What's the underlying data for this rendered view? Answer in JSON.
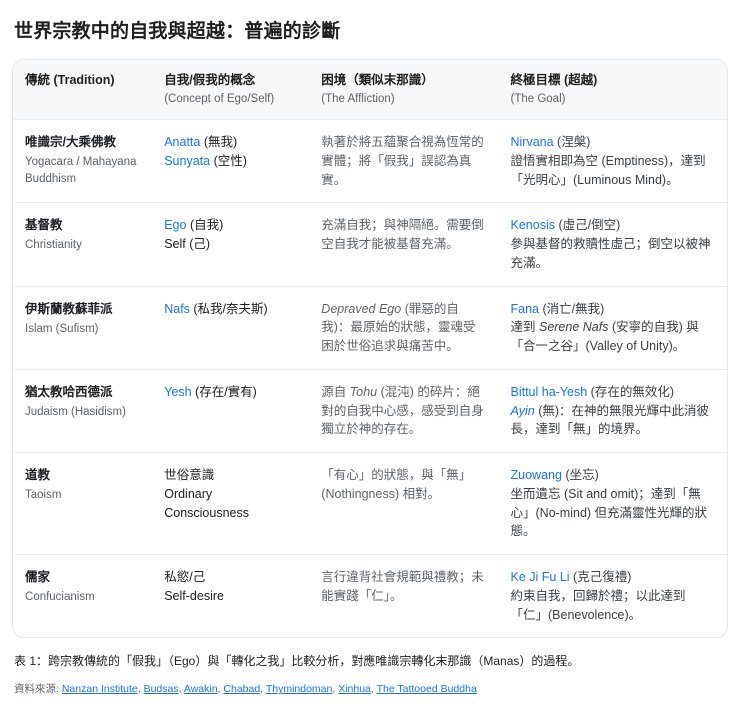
{
  "title": "世界宗教中的自我與超越：普遍的診斷",
  "table": {
    "headers": [
      {
        "main": "傳統 (Tradition)",
        "sub": ""
      },
      {
        "main": "自我/假我的概念",
        "sub": "(Concept of Ego/Self)"
      },
      {
        "main": "困境（類似末那識）",
        "sub": "(The Affliction)"
      },
      {
        "main": "終極目標 (超越)",
        "sub": "(The Goal)"
      }
    ],
    "rows": [
      {
        "tradition": {
          "zh": "唯識宗/大乘佛教",
          "en": "Yogacara / Mahayana Buddhism"
        },
        "concept": [
          [
            {
              "t": "Anatta",
              "s": "link"
            },
            {
              "t": " (無我)"
            }
          ],
          [
            {
              "t": "Sunyata",
              "s": "link"
            },
            {
              "t": " (空性)"
            }
          ]
        ],
        "affliction": [
          [
            {
              "t": "執著於將五蘊聚合視為恆常的實體；將「假我」誤認為真實。"
            }
          ]
        ],
        "goal": [
          [
            {
              "t": "Nirvana",
              "s": "link"
            },
            {
              "t": " (涅槃)"
            }
          ],
          [
            {
              "t": "證悟實相即為空 (Emptiness)，達到「光明心」(Luminous Mind)。"
            }
          ]
        ]
      },
      {
        "tradition": {
          "zh": "基督教",
          "en": "Christianity"
        },
        "concept": [
          [
            {
              "t": "Ego",
              "s": "link"
            },
            {
              "t": " (自我)"
            }
          ],
          [
            {
              "t": "Self (己)"
            }
          ]
        ],
        "affliction": [
          [
            {
              "t": "充滿自我；與神隔絕。需要倒空自我才能被基督充滿。"
            }
          ]
        ],
        "goal": [
          [
            {
              "t": "Kenosis",
              "s": "link"
            },
            {
              "t": " (虛己/倒空)"
            }
          ],
          [
            {
              "t": "參與基督的救贖性虛己；倒空以被神充滿。"
            }
          ]
        ]
      },
      {
        "tradition": {
          "zh": "伊斯蘭教蘇菲派",
          "en": "Islam (Sufism)"
        },
        "concept": [
          [
            {
              "t": "Nafs",
              "s": "link"
            },
            {
              "t": " (私我/奈夫斯)"
            }
          ]
        ],
        "affliction": [
          [
            {
              "t": "Depraved Ego",
              "s": "em"
            },
            {
              "t": " (罪惡的自我)：最原始的狀態，靈魂受困於世俗追求與痛苦中。"
            }
          ]
        ],
        "goal": [
          [
            {
              "t": "Fana",
              "s": "link"
            },
            {
              "t": " (消亡/無我)"
            }
          ],
          [
            {
              "t": "達到 "
            },
            {
              "t": "Serene Nafs",
              "s": "em"
            },
            {
              "t": " (安寧的自我) 與「合一之谷」(Valley of Unity)。"
            }
          ]
        ]
      },
      {
        "tradition": {
          "zh": "猶太教哈西德派",
          "en": "Judaism (Hasidism)"
        },
        "concept": [
          [
            {
              "t": "Yesh",
              "s": "link"
            },
            {
              "t": " (存在/實有)"
            }
          ]
        ],
        "affliction": [
          [
            {
              "t": "源自 "
            },
            {
              "t": "Tohu",
              "s": "em"
            },
            {
              "t": " (混沌) 的碎片：絕對的自我中心感，感受到自身獨立於神的存在。"
            }
          ]
        ],
        "goal": [
          [
            {
              "t": "Bittul ha-Yesh",
              "s": "link"
            },
            {
              "t": " (存在的無效化)"
            }
          ],
          [
            {
              "t": "Ayin",
              "s": "link em"
            },
            {
              "t": " (無)：在神的無限光輝中此消彼長，達到「無」的境界。"
            }
          ]
        ]
      },
      {
        "tradition": {
          "zh": "道教",
          "en": "Taoism"
        },
        "concept": [
          [
            {
              "t": "世俗意識"
            }
          ],
          [
            {
              "t": "Ordinary Consciousness"
            }
          ]
        ],
        "affliction": [
          [
            {
              "t": "「有心」的狀態，與「無」(Nothingness) 相對。"
            }
          ]
        ],
        "goal": [
          [
            {
              "t": "Zuowang",
              "s": "link"
            },
            {
              "t": " (坐忘)"
            }
          ],
          [
            {
              "t": "坐而遺忘 (Sit and omit)；達到「無心」(No-mind) 但充滿靈性光輝的狀態。"
            }
          ]
        ]
      },
      {
        "tradition": {
          "zh": "儒家",
          "en": "Confucianism"
        },
        "concept": [
          [
            {
              "t": "私慾/己"
            }
          ],
          [
            {
              "t": "Self-desire"
            }
          ]
        ],
        "affliction": [
          [
            {
              "t": "言行違背社會規範與禮教；未能實踐「仁」。"
            }
          ]
        ],
        "goal": [
          [
            {
              "t": "Ke Ji Fu Li",
              "s": "link"
            },
            {
              "t": " (克己復禮)"
            }
          ],
          [
            {
              "t": "約束自我，回歸於禮；以此達到「仁」(Benevolence)。"
            }
          ]
        ]
      }
    ]
  },
  "caption": "表 1：跨宗教傳統的「假我」（Ego）與「轉化之我」比較分析，對應唯識宗轉化末那識（Manas）的過程。",
  "sources": {
    "label": "資料來源:",
    "separator": ", ",
    "links": [
      "Nanzan Institute",
      "Budsas",
      "Awakin",
      "Chabad",
      "Thymindoman",
      "Xinhua",
      "The Tattooed Buddha"
    ]
  }
}
